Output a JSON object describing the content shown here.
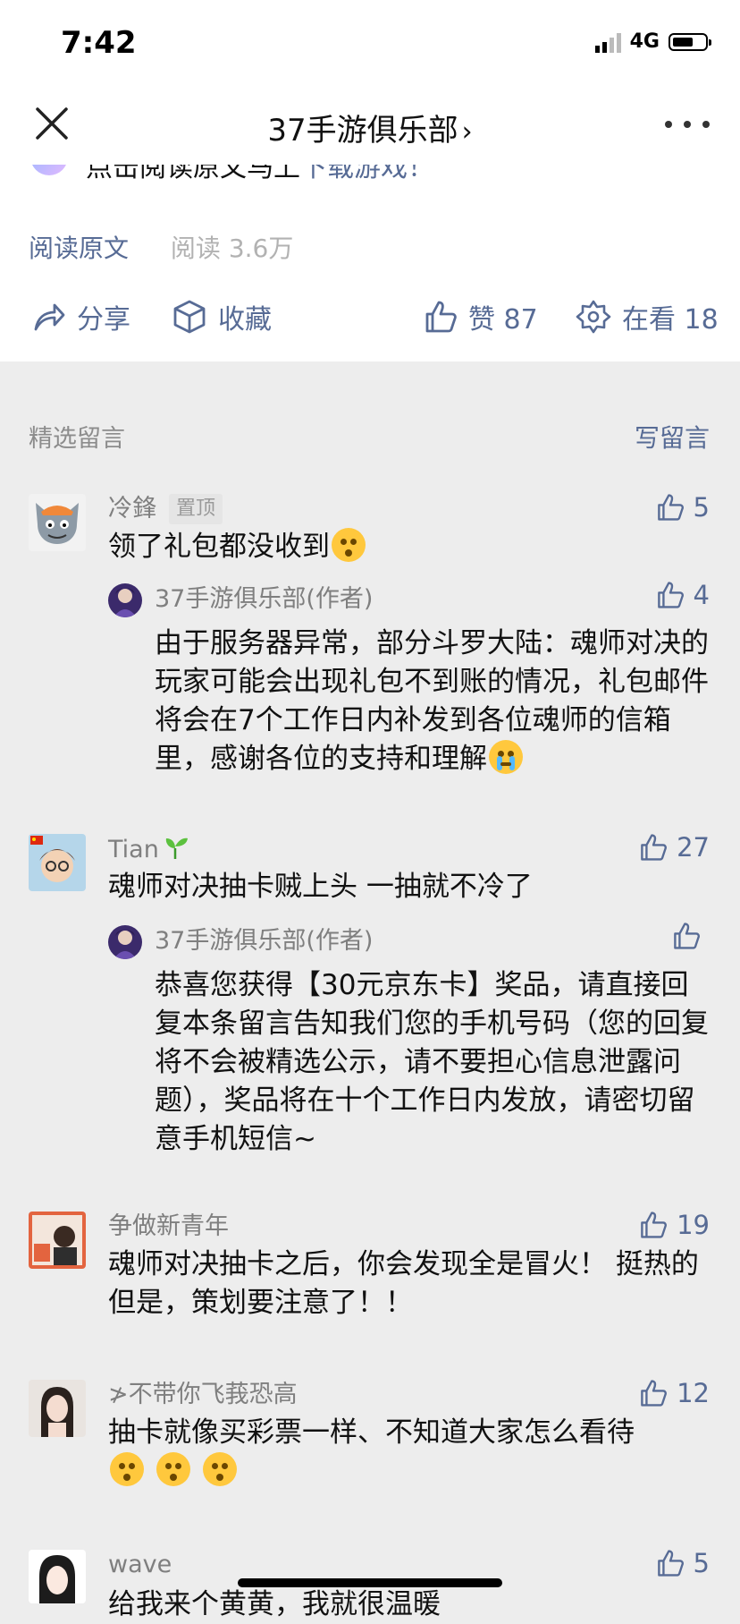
{
  "status_bar": {
    "time": "7:42",
    "network": "4G",
    "battery_level": 0.65
  },
  "nav": {
    "title": "37手游俱乐部",
    "title_chevron": "›"
  },
  "article": {
    "cut_text_prefix": "点击阅读原文马上",
    "cut_text_link": "下载游戏！",
    "read_original": "阅读原文",
    "read_count": "阅读 3.6万",
    "actions": {
      "share": "分享",
      "favorite": "收藏",
      "like": "赞 87",
      "wow": "在看 18"
    }
  },
  "comments_section": {
    "title": "精选留言",
    "write": "写留言"
  },
  "comments": [
    {
      "name": "冷鋒",
      "badge": "置顶",
      "likes": "5",
      "text": "领了礼包都没收到",
      "reply": {
        "name": "37手游俱乐部(作者)",
        "likes": "4",
        "text": "由于服务器异常，部分斗罗大陆：魂师对决的玩家可能会出现礼包不到账的情况，礼包邮件将会在7个工作日内补发到各位魂师的信箱里，感谢各位的支持和理解"
      }
    },
    {
      "name": "Tian",
      "likes": "27",
      "text": "魂师对决抽卡贼上头 一抽就不冷了",
      "reply": {
        "name": "37手游俱乐部(作者)",
        "likes": "",
        "text": "恭喜您获得【30元京东卡】奖品，请直接回复本条留言告知我们您的手机号码（您的回复将不会被精选公示，请不要担心信息泄露问题），奖品将在十个工作日内发放，请密切留意手机短信~"
      }
    },
    {
      "name": "争做新青年",
      "likes": "19",
      "text": "魂师对决抽卡之后，你会发现全是冒火！ 挺热的 但是，策划要注意了！！"
    },
    {
      "name": "≯不带你飞莪恐高",
      "likes": "12",
      "text": "抽卡就像买彩票一样、不知道大家怎么看待"
    },
    {
      "name": "wave",
      "likes": "5",
      "text": "给我来个黄黄，我就很温暖"
    }
  ],
  "colors": {
    "link": "#576b95",
    "background": "#ededed"
  }
}
